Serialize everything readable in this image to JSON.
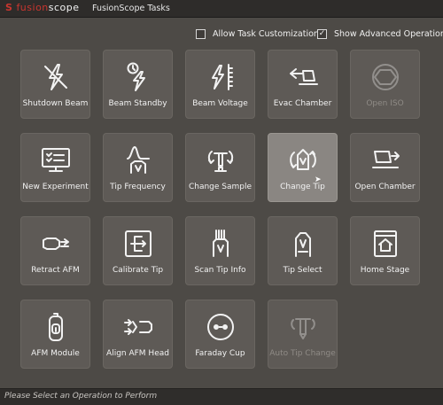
{
  "app": {
    "logo_s": "S",
    "logo_fusion": "fusion",
    "logo_scope": "scope",
    "window_title": "FusionScope Tasks"
  },
  "options": [
    {
      "label": "Allow Task Customization",
      "checked": false
    },
    {
      "label": "Show Advanced Operations",
      "checked": true
    }
  ],
  "tiles": [
    {
      "label": "Shutdown Beam",
      "icon": "beam-off-icon",
      "state": "normal"
    },
    {
      "label": "Beam Standby",
      "icon": "beam-standby-icon",
      "state": "normal"
    },
    {
      "label": "Beam Voltage",
      "icon": "beam-voltage-icon",
      "state": "normal"
    },
    {
      "label": "Evac Chamber",
      "icon": "evac-chamber-icon",
      "state": "normal"
    },
    {
      "label": "Open ISO",
      "icon": "iso-shutter-icon",
      "state": "disabled"
    },
    {
      "label": "New Experiment",
      "icon": "new-experiment-icon",
      "state": "normal"
    },
    {
      "label": "Tip Frequency",
      "icon": "tip-frequency-icon",
      "state": "normal"
    },
    {
      "label": "Change Sample",
      "icon": "change-sample-icon",
      "state": "normal"
    },
    {
      "label": "Change Tip",
      "icon": "change-tip-icon",
      "state": "selected"
    },
    {
      "label": "Open Chamber",
      "icon": "open-chamber-icon",
      "state": "normal"
    },
    {
      "label": "Retract AFM",
      "icon": "retract-afm-icon",
      "state": "normal"
    },
    {
      "label": "Calibrate Tip",
      "icon": "calibrate-tip-icon",
      "state": "normal"
    },
    {
      "label": "Scan Tip Info",
      "icon": "scan-tip-info-icon",
      "state": "normal"
    },
    {
      "label": "Tip Select",
      "icon": "tip-select-icon",
      "state": "normal"
    },
    {
      "label": "Home Stage",
      "icon": "home-stage-icon",
      "state": "normal"
    },
    {
      "label": "AFM Module",
      "icon": "afm-module-icon",
      "state": "normal"
    },
    {
      "label": "Align AFM Head",
      "icon": "align-afm-head-icon",
      "state": "normal"
    },
    {
      "label": "Faraday Cup",
      "icon": "faraday-cup-icon",
      "state": "normal"
    },
    {
      "label": "Auto Tip Change",
      "icon": "auto-tip-change-icon",
      "state": "disabled"
    }
  ],
  "status": {
    "text": "Please Select an Operation to Perform"
  },
  "colors": {
    "accent": "#c9362f",
    "background": "#4d4a46",
    "tile": "#5e5a56",
    "tile_selected": "#8a8682"
  }
}
